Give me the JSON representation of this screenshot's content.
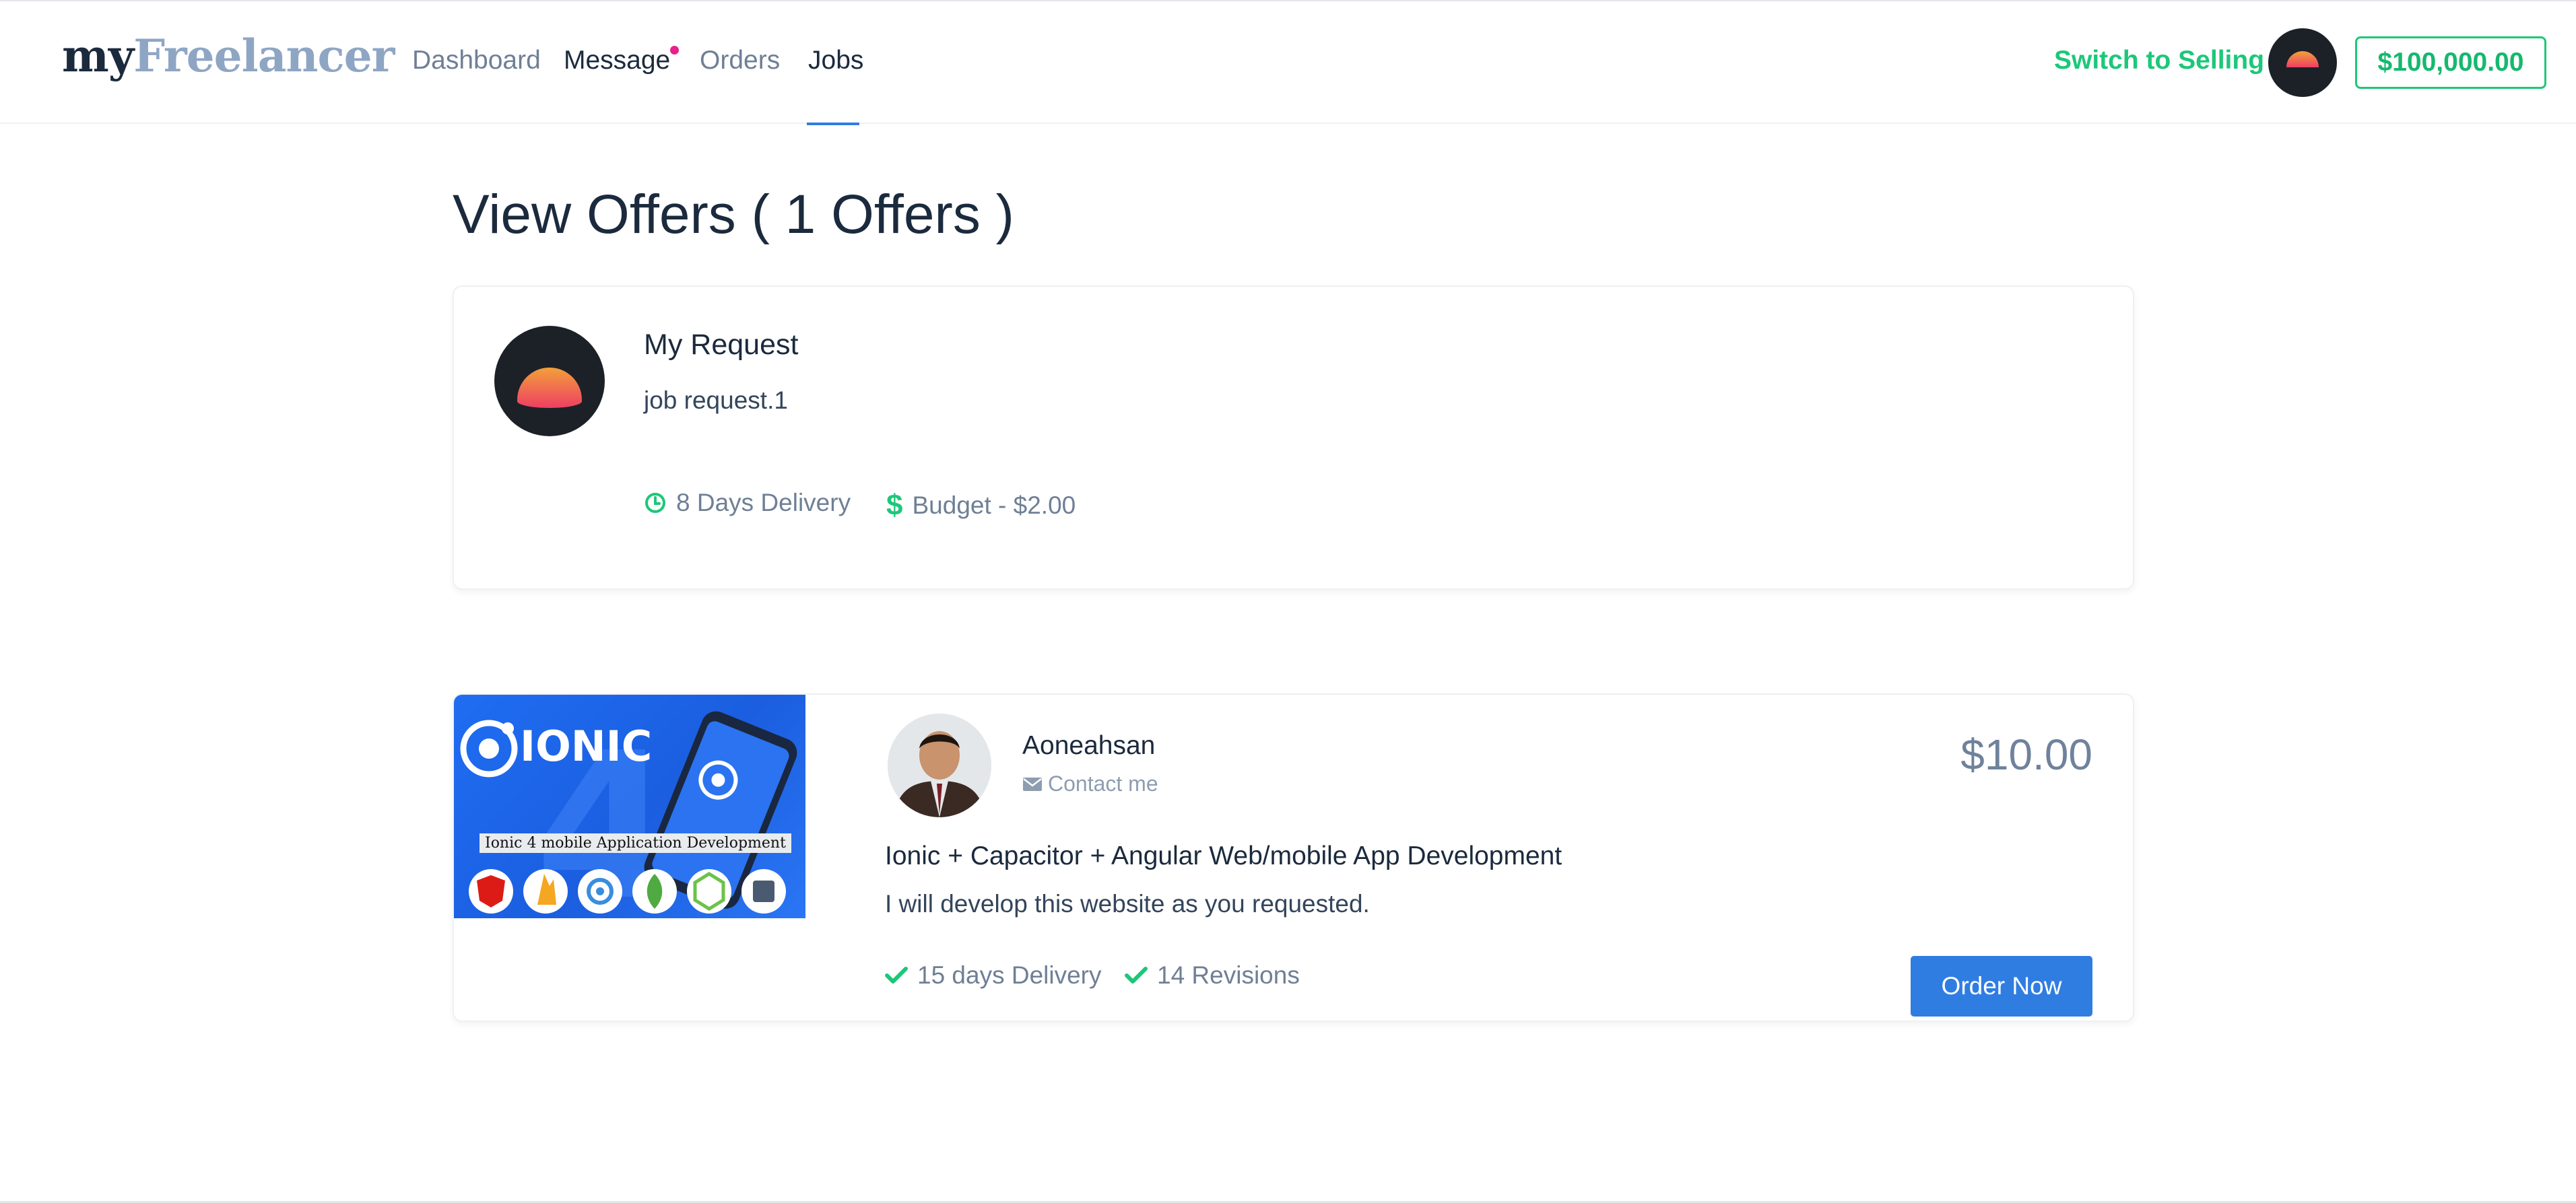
{
  "brand": {
    "part1": "my",
    "part2": "Freelancer"
  },
  "nav": {
    "items": [
      {
        "label": "Dashboard"
      },
      {
        "label": "Message"
      },
      {
        "label": "Orders"
      },
      {
        "label": "Jobs"
      }
    ],
    "active": "Jobs",
    "switch_label": "Switch to Selling",
    "balance": "$100,000.00"
  },
  "page": {
    "title": "View Offers ( 1 Offers )"
  },
  "request": {
    "title": "My Request",
    "description": "job request.1",
    "delivery": "8 Days Delivery",
    "budget": "Budget - $2.00"
  },
  "offer": {
    "thumbnail_caption": "Ionic 4 mobile Application Development",
    "thumbnail_brand": "ionic",
    "seller_name": "Aoneahsan",
    "contact_label": "Contact me",
    "price": "$10.00",
    "title": "Ionic + Capacitor + Angular Web/mobile App Development",
    "description": "I will develop this website as you requested.",
    "delivery": "15 days Delivery",
    "revisions": "14 Revisions",
    "order_button": "Order Now"
  },
  "colors": {
    "accent_green": "#1dc779",
    "primary_blue": "#2f7de1",
    "notification_pink": "#e8208c",
    "text_dark": "#1b2a3d"
  },
  "icons": {
    "clock": "clock-icon",
    "dollar": "dollar-icon",
    "envelope": "envelope-icon",
    "check": "check-icon"
  }
}
